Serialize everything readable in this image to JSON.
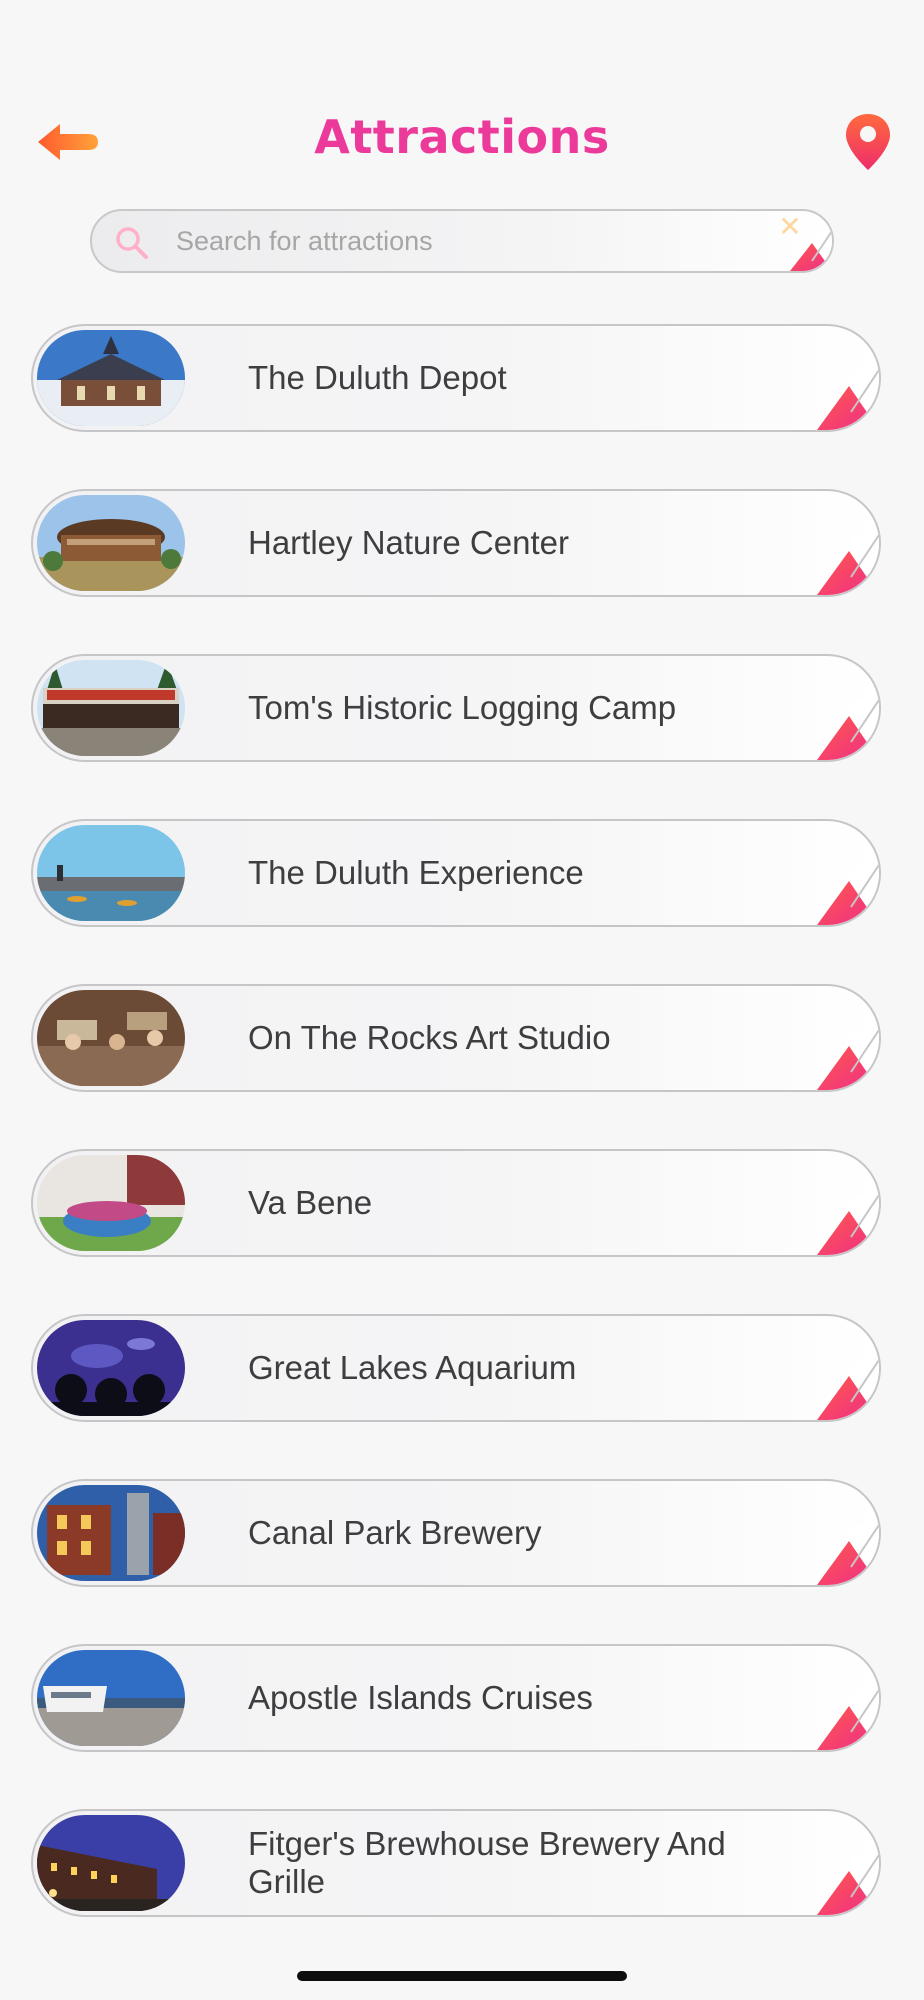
{
  "header": {
    "title": "Attractions",
    "back_icon": "back-arrow-icon",
    "map_icon": "map-pin-icon"
  },
  "search": {
    "placeholder": "Search for attractions",
    "value": "",
    "icon": "search-icon",
    "clear_icon": "close-icon"
  },
  "colors": {
    "accent": "#ec3a9b",
    "corner_start": "#f13a86",
    "corner_end": "#ff6a3d",
    "back_arrow": "#ff6f3a"
  },
  "attractions": [
    {
      "label": "The Duluth Depot"
    },
    {
      "label": "Hartley Nature Center"
    },
    {
      "label": "Tom's Historic Logging Camp"
    },
    {
      "label": "The Duluth Experience"
    },
    {
      "label": "On The Rocks Art Studio"
    },
    {
      "label": "Va Bene"
    },
    {
      "label": "Great Lakes Aquarium"
    },
    {
      "label": "Canal Park Brewery"
    },
    {
      "label": "Apostle Islands Cruises"
    },
    {
      "label": "Fitger's Brewhouse Brewery And Grille"
    }
  ]
}
